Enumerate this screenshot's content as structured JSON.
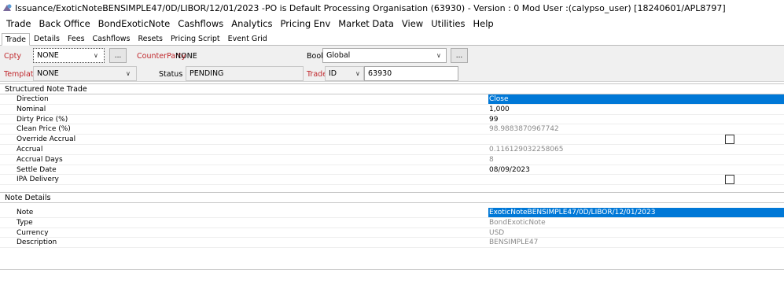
{
  "window": {
    "title": "Issuance/ExoticNoteBENSIMPLE47/0D/LIBOR/12/01/2023  -PO is Default Processing Organisation  (63930) - Version : 0 Mod User :(calypso_user)  [18240601/APL8797]"
  },
  "menu": [
    "Trade",
    "Back Office",
    "BondExoticNote",
    "Cashflows",
    "Analytics",
    "Pricing Env",
    "Market Data",
    "View",
    "Utilities",
    "Help"
  ],
  "tabs": [
    "Trade",
    "Details",
    "Fees",
    "Cashflows",
    "Resets",
    "Pricing Script",
    "Event Grid"
  ],
  "form": {
    "cpty_label": "Cpty",
    "cpty_value": "NONE",
    "cpty_button": "...",
    "counterparty_label": "CounterParty",
    "counterparty_value": "NONE",
    "book_label": "Book",
    "book_value": "Global",
    "book_button": "...",
    "template_label": "Template",
    "template_value": "NONE",
    "status_label": "Status",
    "status_value": "PENDING",
    "trade_label": "Trade",
    "trade_id_type": "ID",
    "trade_id_value": "63930"
  },
  "structured": {
    "title": "Structured Note Trade",
    "rows": [
      {
        "name": "Direction",
        "value": "Close"
      },
      {
        "name": "Nominal",
        "value": "1,000"
      },
      {
        "name": "Dirty Price (%)",
        "value": "99"
      },
      {
        "name": "Clean Price (%)",
        "value": "98.9883870967742"
      },
      {
        "name": "Override Accrual",
        "value": ""
      },
      {
        "name": "Accrual",
        "value": "0.116129032258065"
      },
      {
        "name": "Accrual Days",
        "value": "8"
      },
      {
        "name": "Settle Date",
        "value": "08/09/2023"
      },
      {
        "name": "IPA Delivery",
        "value": ""
      }
    ]
  },
  "note": {
    "title": "Note Details",
    "rows": [
      {
        "name": "Note",
        "value": "ExoticNoteBENSIMPLE47/0D/LIBOR/12/01/2023"
      },
      {
        "name": "Type",
        "value": "BondExoticNote"
      },
      {
        "name": "Currency",
        "value": "USD"
      },
      {
        "name": "Description",
        "value": "BENSIMPLE47"
      }
    ]
  },
  "colors": {
    "selection": "#0078d7",
    "label_red": "#c0282d",
    "form_bg": "#f0f0f0"
  }
}
